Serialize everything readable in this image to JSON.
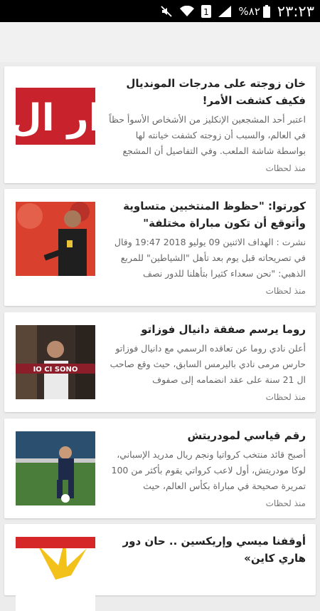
{
  "status_bar": {
    "time": "٢٣:٢٣",
    "battery_percent": "%٨٢",
    "sim_label": "1",
    "icons": [
      "mute-icon",
      "wifi-icon",
      "sim-icon",
      "signal-icon",
      "battery-icon"
    ]
  },
  "articles": [
    {
      "headline": "خان زوجته على مدرجات المونديال فكيف كشفت الأمر!",
      "excerpt": "اعتبر أحد المشجعين الإنكليز من الأشخاص الأسوأ حظاً في العالم، والسبب أن زوجته كشفت خيانته لها بواسطة شاشة الملعب. وفي التفاصيل أن المشجع",
      "time": "منذ لحظات",
      "thumb_text": "ار ال"
    },
    {
      "headline": "كورتوا: \"حظوظ المنتخبين متساوية وأتوقع أن تكون مباراة مختلفة\"",
      "excerpt": "نشرت : الهداف الاثنين 09 يوليو 2018 19:47 وقال في تصريحاته قبل يوم بعد تأهل \"الشياطين\" للمربع الذهبي: \"نحن سعداء كثيرا بتأهلنا للدور نصف",
      "time": "منذ لحظات"
    },
    {
      "headline": "روما يرسم صفقة دانيال فوزاتو",
      "excerpt": "أعلن نادي روما عن تعاقده الرسمي مع دانيال فوزاتو حارس مرمى نادي باليرمس السابق، حيث وقع صاحب ال 21 سنة على عقد انضمامه إلى صفوف",
      "time": "منذ لحظات",
      "thumb_text": "IO CI SONO"
    },
    {
      "headline": "رقم قياسي لمودريتش",
      "excerpt": "أصبح قائد منتخب كرواتيا ونجم ريال مدريد الإسباني، لوكا مودريتش، أول لاعب كرواتي يقوم بأكثر من 100 تمريرة صحيحة في مباراة بكأس العالم، حيث",
      "time": "منذ لحظات"
    },
    {
      "headline": "أوقفنا ميسي وإريكسين .. حان دور هاري كاين»",
      "excerpt": "",
      "time": ""
    }
  ]
}
